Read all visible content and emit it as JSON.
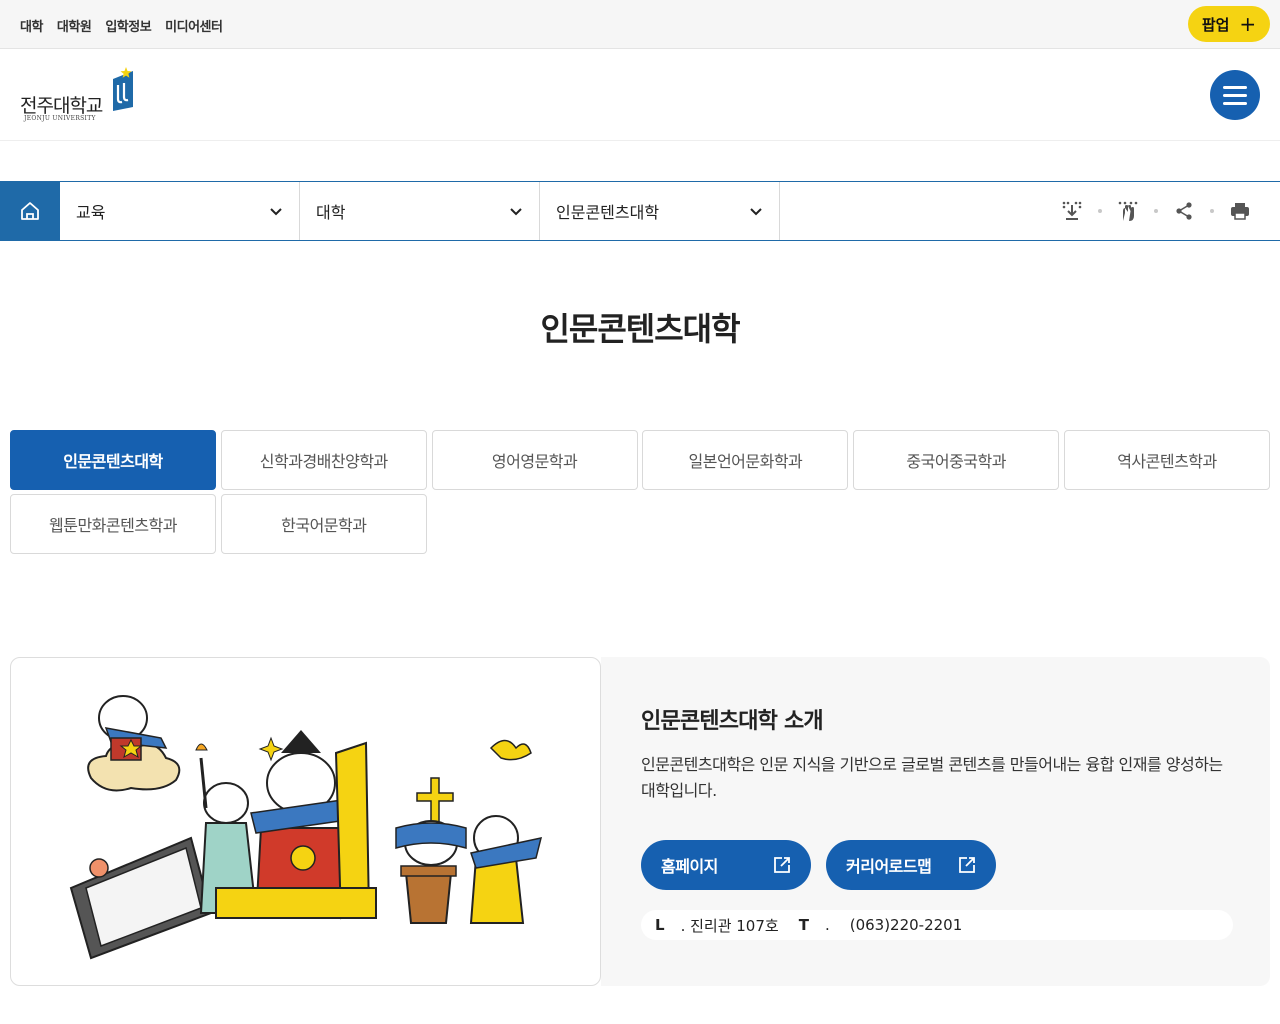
{
  "topbar": {
    "links": [
      "대학",
      "대학원",
      "입학정보",
      "미디어센터"
    ],
    "popup_label": "팝업",
    "popup_plus": "+"
  },
  "header": {
    "logo_text": "전주대학교",
    "logo_sub": "JEONJU UNIVERSITY"
  },
  "location": {
    "items": [
      "교육",
      "대학",
      "인문콘텐츠대학"
    ]
  },
  "page": {
    "title": "인문콘텐츠대학"
  },
  "tabs": [
    "인문콘텐츠대학",
    "신학과경배찬양학과",
    "영어영문학과",
    "일본언어문화학과",
    "중국어중국학과",
    "역사콘텐츠학과",
    "웹툰만화콘텐츠학과",
    "한국어문학과"
  ],
  "intro": {
    "title": "인문콘텐츠대학 소개",
    "description": "인문콘텐츠대학은 인문 지식을 기반으로 글로벌 콘텐츠를 만들어내는 융합 인재를 양성하는 대학입니다.",
    "homepage_label": "홈페이지",
    "career_label": "커리어로드맵",
    "contact_l_key": "L",
    "contact_l_value": ". 진리관 107호",
    "contact_t_key": "T",
    "contact_t_value": ".",
    "contact_phone": "(063)220-2201"
  },
  "colors": {
    "primary": "#1660b0",
    "location_blue": "#1f6aa8",
    "popup_yellow": "#f5d312"
  }
}
